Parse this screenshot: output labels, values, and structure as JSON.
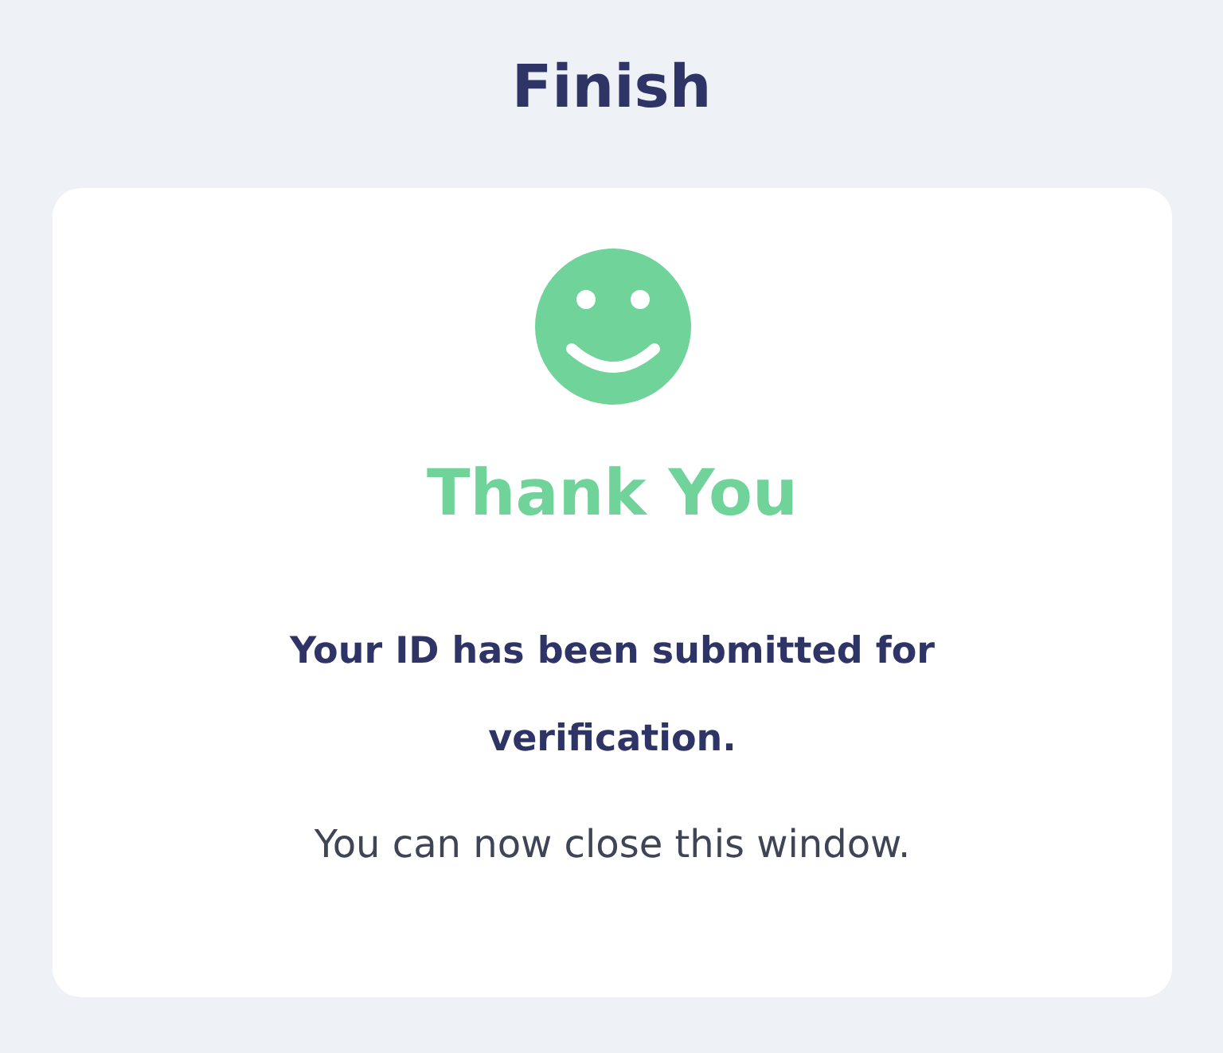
{
  "header": {
    "title": "Finish"
  },
  "card": {
    "heading": "Thank You",
    "message": "Your ID has been submitted for verification.",
    "note": "You can now close this window."
  }
}
